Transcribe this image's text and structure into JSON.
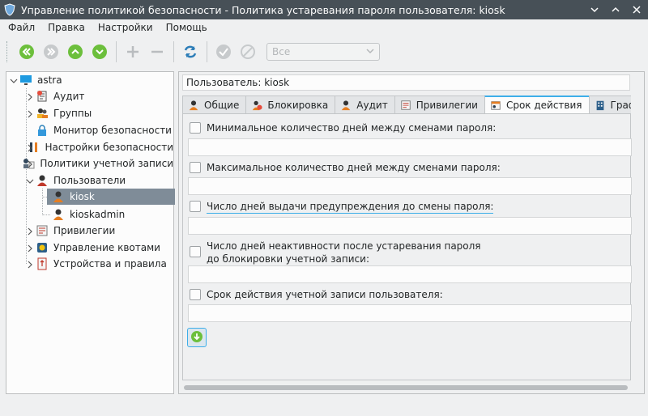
{
  "window": {
    "title": "Управление политикой безопасности - Политика устаревания пароля пользователя: kiosk"
  },
  "menu": {
    "file": "Файл",
    "edit": "Правка",
    "settings": "Настройки",
    "help": "Помощь"
  },
  "toolbar": {
    "filter_value": "Все"
  },
  "tree": {
    "items": [
      {
        "label": "astra",
        "icon": "monitor-icon"
      },
      {
        "label": "Аудит",
        "icon": "audit-icon"
      },
      {
        "label": "Группы",
        "icon": "groups-icon"
      },
      {
        "label": "Монитор безопасности",
        "icon": "lock-icon"
      },
      {
        "label": "Настройки безопасности",
        "icon": "tools-icon"
      },
      {
        "label": "Политики учетной записи",
        "icon": "account-policy-icon"
      },
      {
        "label": "Пользователи",
        "icon": "users-icon"
      },
      {
        "label": "kiosk",
        "icon": "user-icon"
      },
      {
        "label": "kioskadmin",
        "icon": "user-icon"
      },
      {
        "label": "Привилегии",
        "icon": "privileges-icon"
      },
      {
        "label": "Управление квотами",
        "icon": "quota-icon"
      },
      {
        "label": "Устройства и правила",
        "icon": "devices-icon"
      }
    ]
  },
  "details": {
    "user_line": "Пользователь: kiosk",
    "tabs": [
      {
        "label": "Общие"
      },
      {
        "label": "Блокировка"
      },
      {
        "label": "Аудит"
      },
      {
        "label": "Привилегии"
      },
      {
        "label": "Срок действия"
      },
      {
        "label": "Графическ"
      }
    ],
    "fields": [
      {
        "label": "Минимальное количество дней между сменами пароля:",
        "value": ""
      },
      {
        "label": "Максимальное количество дней между сменами пароля:",
        "value": ""
      },
      {
        "label": "Число дней выдачи предупреждения до смены пароля:",
        "value": ""
      },
      {
        "label": "Число дней неактивности после устаревания пароля\nдо блокировки учетной записи:",
        "value": ""
      },
      {
        "label": "Срок действия учетной записи пользователя:",
        "value": ""
      }
    ]
  },
  "colors": {
    "titlebar": "#475057",
    "accent": "#3daee9",
    "selection": "#7f8c98",
    "nav_green": "#6cbf3c"
  }
}
